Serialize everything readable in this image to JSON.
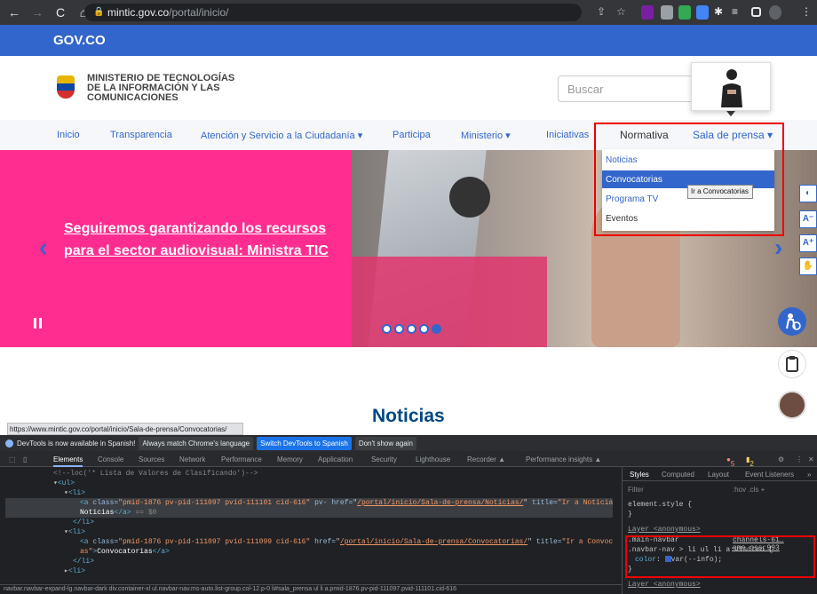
{
  "browser": {
    "url_host": "mintic.gov.co",
    "url_path": "/portal/inicio/"
  },
  "gov_bar": {
    "label": "GOV.CO"
  },
  "header": {
    "ministry": "MINISTERIO DE TECNOLOGÍAS DE LA INFORMACIÓN Y LAS COMUNICACIONES",
    "search_placeholder": "Buscar"
  },
  "menu": {
    "items": [
      "Inicio",
      "Transparencia",
      "Atención y Servicio a la Ciudadanía ▾",
      "Participa",
      "Ministerio ▾",
      "Iniciativas",
      "Normativa",
      "Sala de prensa ▾"
    ]
  },
  "dropdown": {
    "items": [
      "Noticias",
      "Convocatorias",
      "Programa TV",
      "Eventos"
    ],
    "tooltip": "Ir a Convocatorias"
  },
  "hero": {
    "headline": "Seguiremos garantizando los recursos para el sector audiovisual: Ministra TIC",
    "active_slide": 5,
    "slide_count": 5
  },
  "accessibility": [
    "◐",
    "A⁻",
    "A⁺",
    "✋"
  ],
  "section_title": "Noticias",
  "status_url": "https://www.mintic.gov.co/portal/inicio/Sala-de-prensa/Convocatorias/",
  "devtools": {
    "banner": {
      "message": "DevTools is now available in Spanish!",
      "btn_match": "Always match Chrome's language",
      "btn_switch": "Switch DevTools to Spanish",
      "btn_dismiss": "Don't show again"
    },
    "tabs": [
      "Elements",
      "Console",
      "Sources",
      "Network",
      "Performance",
      "Memory",
      "Application",
      "Security",
      "Lighthouse",
      "Recorder ▲",
      "Performance insights ▲"
    ],
    "counts": {
      "errors": "5",
      "warnings": "2"
    },
    "code": {
      "line0": "<!--loc('* Lista de Valores de Clasificando')-->",
      "ul": "<ul>",
      "li": "<li>",
      "li_close": "</li>",
      "ul_close": "</ul>",
      "a1_class": "pmid-1876 pv-pid-111097 pvid-111101 cid-616",
      "a1_href": "/portal/inicio/Sala-de-prensa/Noticias/",
      "a1_title": "Ir a Noticias",
      "a1_text": "Noticias",
      "eq": "== $0",
      "a2_class": "pmid-1876 pv-pid-111097 pvid-111099 cid-616",
      "a2_href": "/portal/inicio/Sala-de-prensa/Convocatorias/",
      "a2_title": "Ir a Convocatori",
      "a2_cont": "as",
      "a2_text": "Convocatorias"
    },
    "breadcrumbs": "navbar.navbar-expand-lg.navbar-dark   div.container-xl   ul.navbar-nav.ms-auto.list-group.col-12.p-0   li#sala_prensa   ul   li   a.pmid-1876.pv-pid-111097.pvid-111101.cid-616",
    "styles": {
      "tabs": [
        "Styles",
        "Computed",
        "Layout",
        "Event Listeners",
        "»"
      ],
      "filter": "Filter",
      "filter_tools": ":hov .cls +",
      "element_style": "element.style {",
      "close": "}",
      "layer": "Layer <anonymous>",
      "selector1": ".main-navbar",
      "selector2": ".navbar-nav > li ul li a:visited {",
      "source": "channels-61…eme.css:993",
      "prop": "color",
      "value": "var(--info);",
      "layer2": "Layer <anonymous>"
    }
  }
}
